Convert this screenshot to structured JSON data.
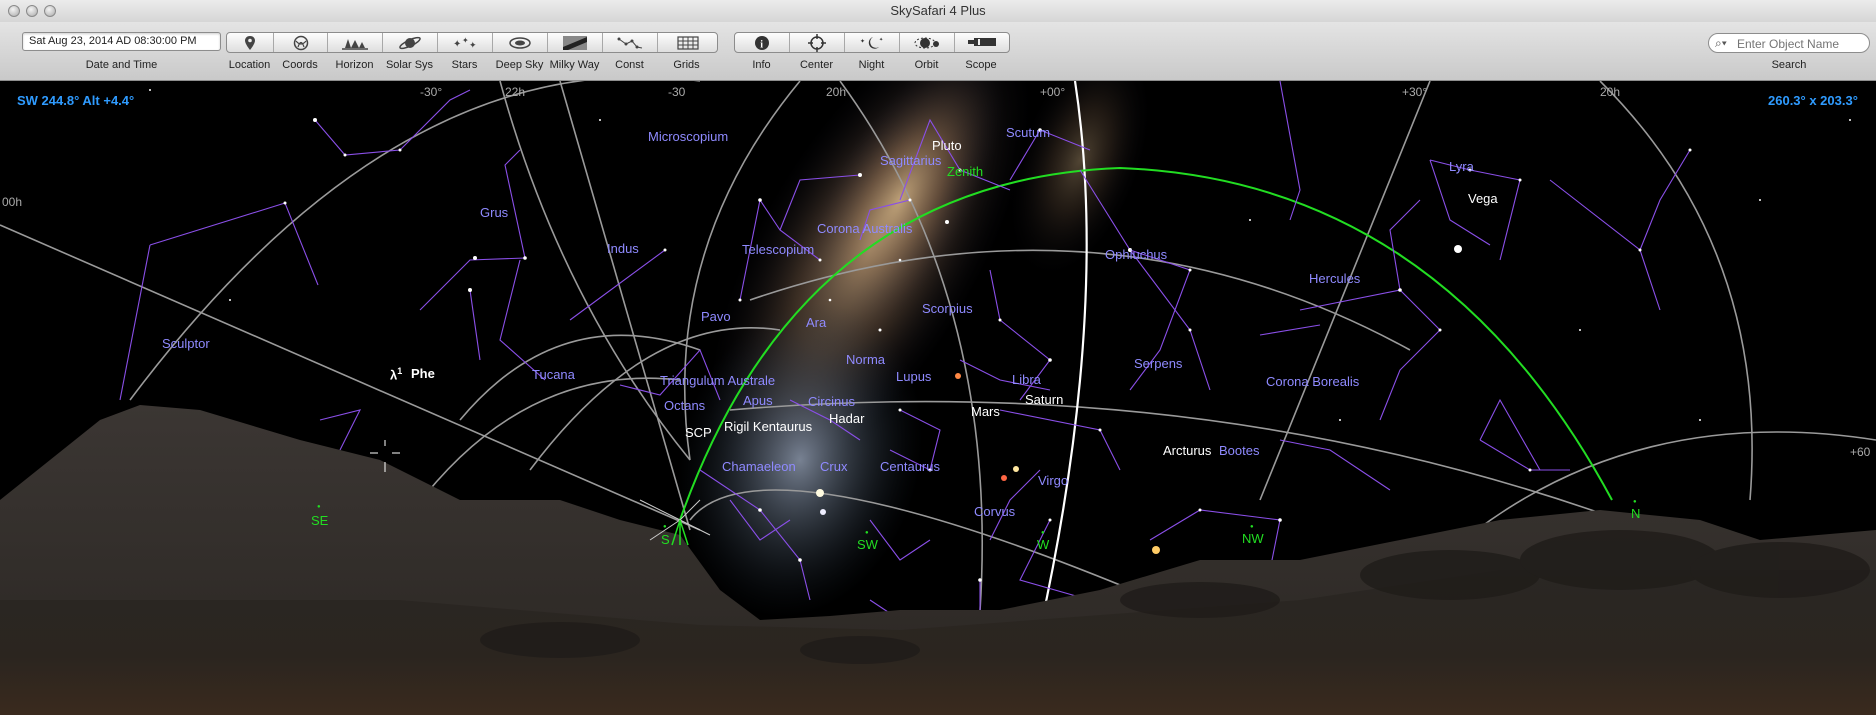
{
  "window": {
    "title": "SkySafari 4 Plus"
  },
  "toolbar": {
    "datetime": {
      "value": "Sat Aug 23, 2014 AD 08:30:00 PM",
      "label": "Date and Time"
    },
    "view_buttons": [
      {
        "label": "Location",
        "icon": "pin-icon"
      },
      {
        "label": "Coords",
        "icon": "coords-icon"
      },
      {
        "label": "Horizon",
        "icon": "horizon-icon"
      },
      {
        "label": "Solar Sys",
        "icon": "saturn-icon"
      },
      {
        "label": "Stars",
        "icon": "stars-icon"
      },
      {
        "label": "Deep Sky",
        "icon": "galaxy-icon"
      },
      {
        "label": "Milky Way",
        "icon": "milky-way-icon"
      },
      {
        "label": "Const",
        "icon": "constellation-icon"
      },
      {
        "label": "Grids",
        "icon": "grid-icon"
      }
    ],
    "action_buttons": [
      {
        "label": "Info",
        "icon": "info-icon"
      },
      {
        "label": "Center",
        "icon": "crosshair-icon"
      },
      {
        "label": "Night",
        "icon": "moon-icon"
      },
      {
        "label": "Orbit",
        "icon": "orbit-icon"
      },
      {
        "label": "Scope",
        "icon": "telescope-icon"
      }
    ],
    "search": {
      "placeholder": "Enter Object Name",
      "label": "Search"
    }
  },
  "sky": {
    "readout_left": "SW 244.8° Alt +4.4°",
    "readout_right": "260.3° x 203.3°",
    "grid_labels": [
      "-30°",
      "22h",
      "-30",
      "20h",
      "+00°",
      "+30°",
      "20h",
      "00h",
      "+60"
    ],
    "constellations": [
      "Microscopium",
      "Grus",
      "Indus",
      "Telescopium",
      "Corona Australis",
      "Sagittarius",
      "Scutum",
      "Ophiuchus",
      "Lyra",
      "Hercules",
      "Sculptor",
      "Tucana",
      "Pavo",
      "Ara",
      "Scorpius",
      "Norma",
      "Lupus",
      "Libra",
      "Serpens",
      "Corona Borealis",
      "Triangulum Australe",
      "Apus",
      "Circinus",
      "Octans",
      "Chamaeleon",
      "Crux",
      "Centaurus",
      "Virgo",
      "Bootes",
      "Corvus"
    ],
    "objects": [
      "Pluto",
      "Vega",
      "Saturn",
      "Mars",
      "Hadar",
      "Rigil Kentaurus",
      "Arcturus",
      "SCP",
      "Zenith"
    ],
    "phe_label": "Phe",
    "lambda_label": "λ",
    "lambda_sup": "1",
    "compass": [
      "SE",
      "S",
      "SW",
      "W",
      "NW",
      "N"
    ]
  }
}
